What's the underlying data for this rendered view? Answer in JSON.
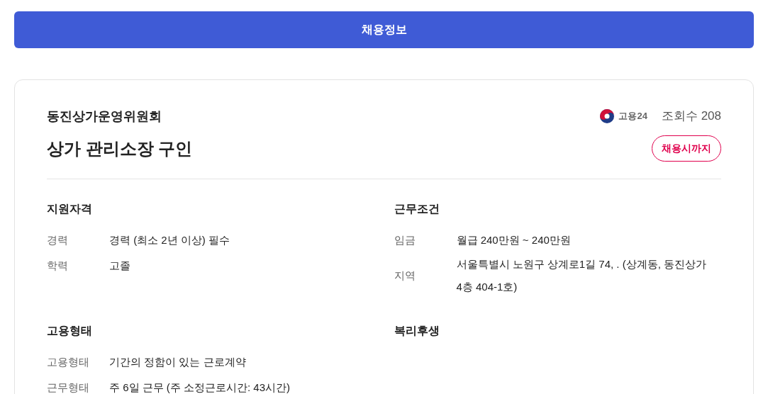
{
  "header_button": "채용정보",
  "job": {
    "company": "동진상가운영위원회",
    "title": "상가 관리소장 구인",
    "source": "고용24",
    "views": "조회수 208",
    "deadline": "채용시까지"
  },
  "sections": [
    {
      "title": "지원자격",
      "rows": [
        {
          "label": "경력",
          "value": "경력 (최소 2년 이상) 필수"
        },
        {
          "label": "학력",
          "value": "고졸"
        }
      ]
    },
    {
      "title": "근무조건",
      "rows": [
        {
          "label": "임금",
          "value": "월급 240만원 ~ 240만원"
        },
        {
          "label": "지역",
          "value": "서울특별시 노원구 상계로1길 74, . (상계동, 동진상가 4층 404-1호)"
        }
      ]
    },
    {
      "title": "고용형태",
      "rows": [
        {
          "label": "고용형태",
          "value": "기간의 정함이 있는 근로계약"
        },
        {
          "label": "근무형태",
          "value": "주 6일 근무 (주 소정근로시간: 43시간)"
        }
      ]
    },
    {
      "title": "복리후생"
    }
  ]
}
